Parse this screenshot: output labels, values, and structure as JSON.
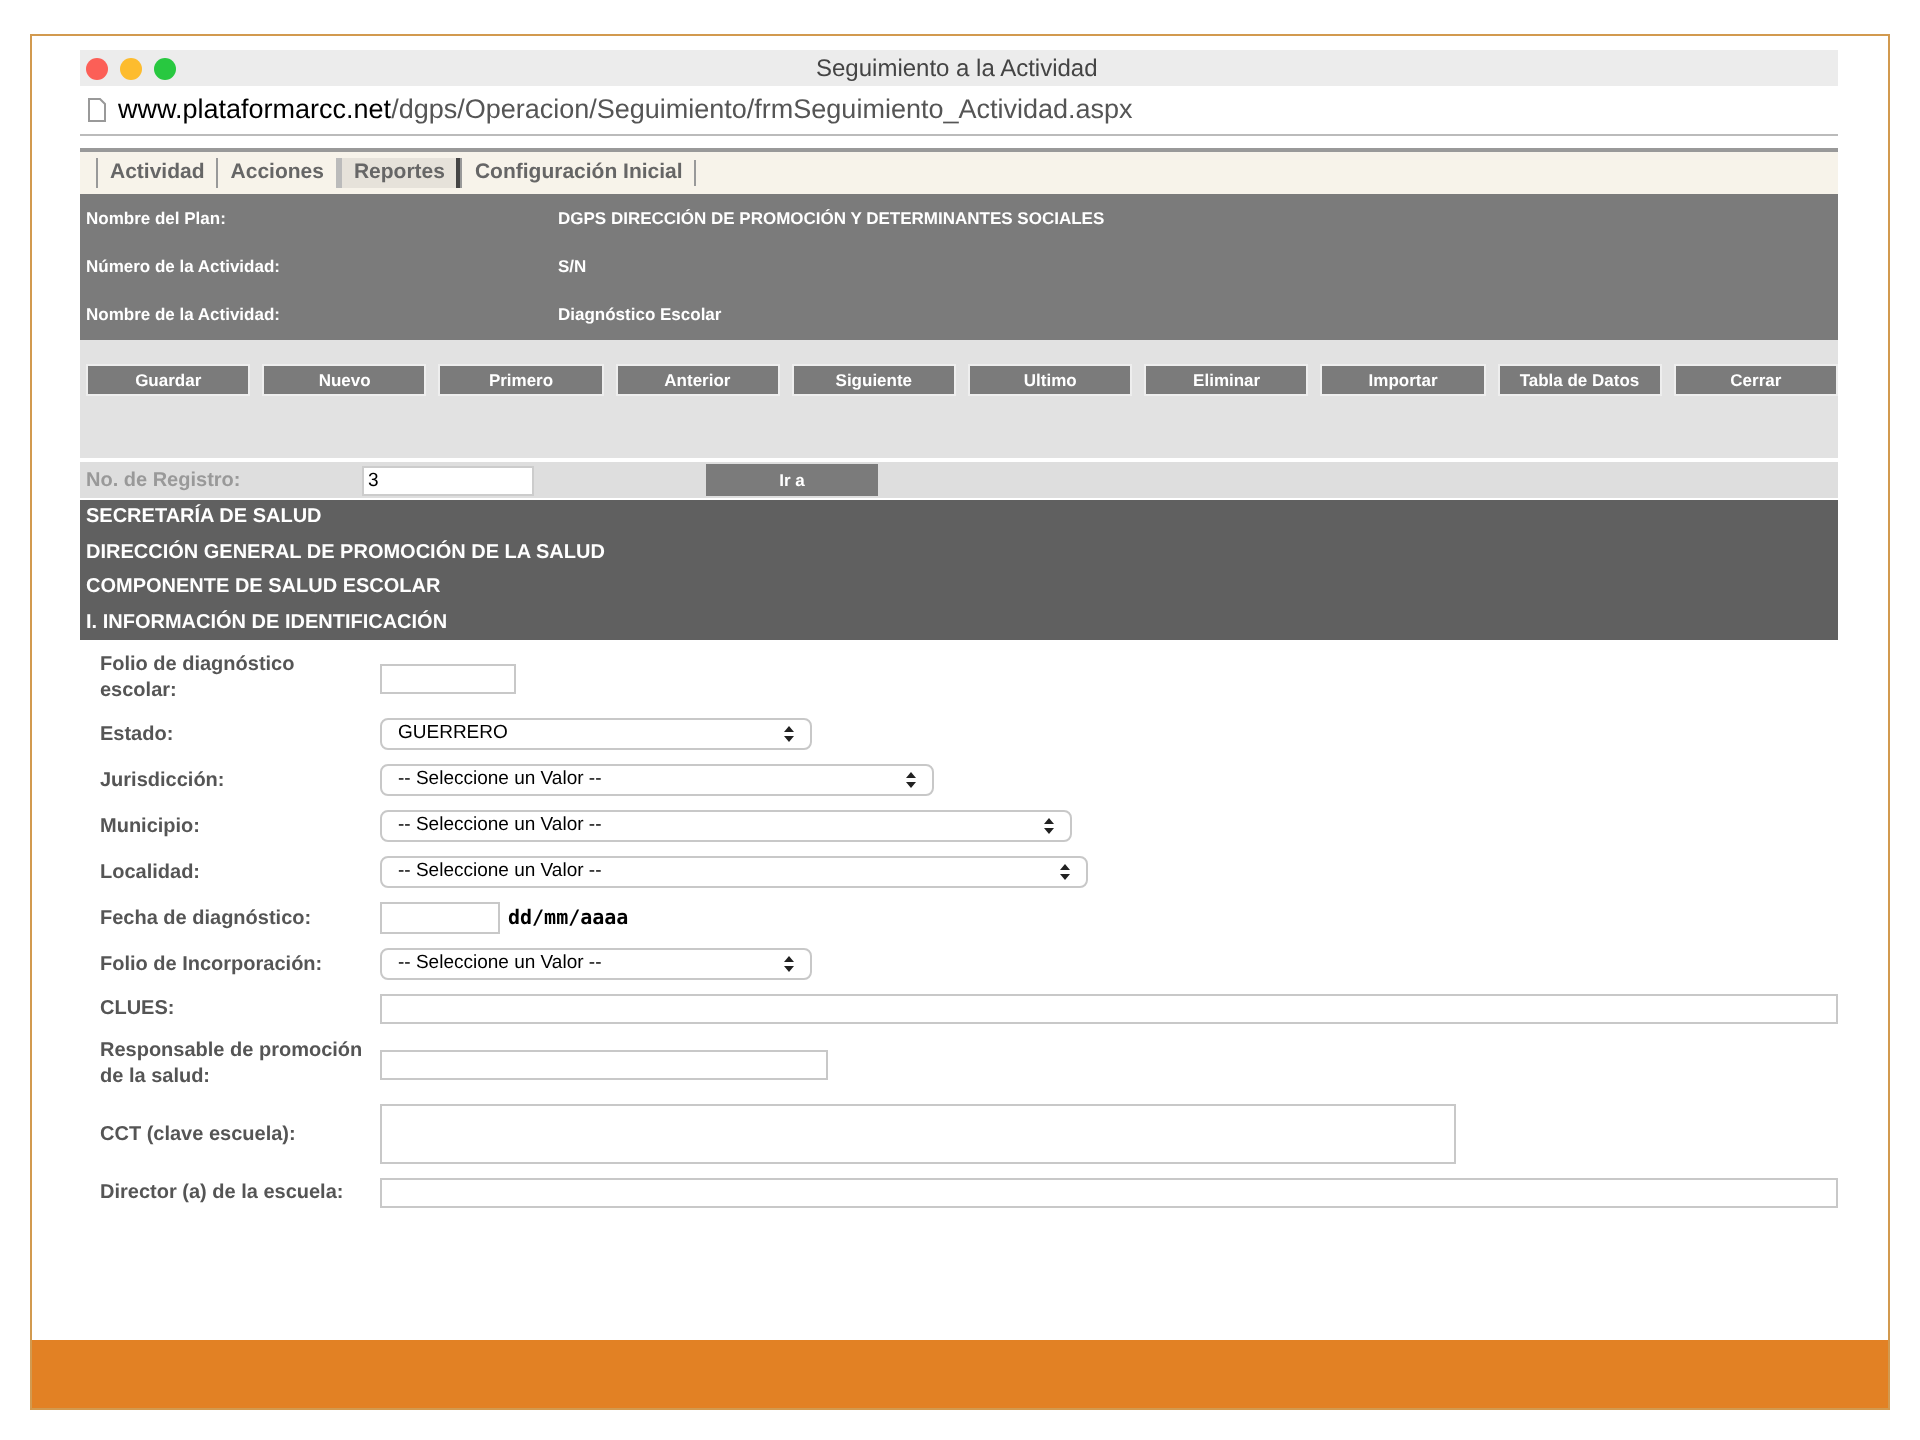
{
  "window": {
    "title": "Seguimiento a la Actividad"
  },
  "address_bar": {
    "domain": "www.plataformarcc.net",
    "path": "/dgps/Operacion/Seguimiento/frmSeguimiento_Actividad.aspx"
  },
  "menu": [
    {
      "label": "Actividad",
      "selected": false
    },
    {
      "label": "Acciones",
      "selected": false
    },
    {
      "label": "Reportes",
      "selected": true
    },
    {
      "label": "Configuración Inicial",
      "selected": false
    }
  ],
  "plan_info": [
    {
      "label": "Nombre del Plan:",
      "value": "DGPS DIRECCIÓN DE PROMOCIÓN Y DETERMINANTES SOCIALES"
    },
    {
      "label": "Número de la Actividad:",
      "value": "S/N"
    },
    {
      "label": "Nombre de la Actividad:",
      "value": "Diagnóstico Escolar"
    }
  ],
  "toolbar_buttons": [
    "Guardar",
    "Nuevo",
    "Primero",
    "Anterior",
    "Siguiente",
    "Ultimo",
    "Eliminar",
    "Importar",
    "Tabla de Datos",
    "Cerrar"
  ],
  "registro": {
    "label": "No. de Registro:",
    "value": "3",
    "button": "Ir a"
  },
  "section_headings": [
    "SECRETARÍA DE SALUD",
    "DIRECCIÓN GENERAL DE PROMOCIÓN DE LA SALUD",
    "COMPONENTE DE SALUD ESCOLAR",
    "I. INFORMACIÓN DE IDENTIFICACIÓN"
  ],
  "form_fields": [
    {
      "label": "Folio de diagnóstico escolar:",
      "kind": "text"
    },
    {
      "label": "Estado:",
      "kind": "select",
      "value": "GUERRERO"
    },
    {
      "label": "Jurisdicción:",
      "kind": "select",
      "value": "-- Seleccione un Valor --"
    },
    {
      "label": "Municipio:",
      "kind": "select",
      "value": "-- Seleccione un Valor --"
    },
    {
      "label": "Localidad:",
      "kind": "select",
      "value": "-- Seleccione un Valor --"
    },
    {
      "label": "Fecha de diagnóstico:",
      "kind": "date",
      "hint": "dd/mm/aaaa"
    },
    {
      "label": "Folio de Incorporación:",
      "kind": "select",
      "value": "-- Seleccione un Valor --"
    },
    {
      "label": "CLUES:",
      "kind": "text"
    },
    {
      "label": "Responsable de promoción de la salud:",
      "kind": "text"
    },
    {
      "label": "CCT (clave escuela):",
      "kind": "textarea"
    },
    {
      "label": "Director (a) de la escuela:",
      "kind": "text"
    }
  ]
}
